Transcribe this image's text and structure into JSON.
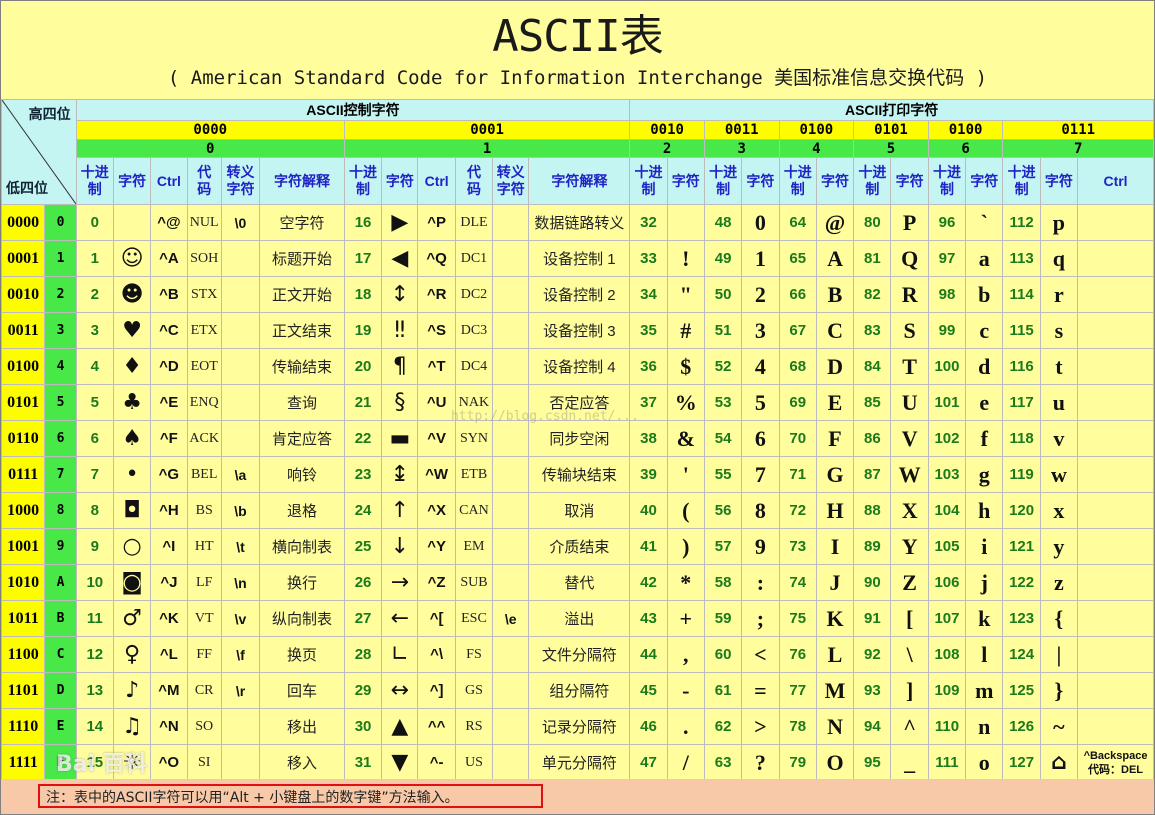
{
  "title": "ASCII表",
  "subtitle": "( American Standard Code for Information Interchange  美国标准信息交换代码 )",
  "corner": {
    "high": "高四位",
    "low": "低四位"
  },
  "categories": {
    "control": "ASCII控制字符",
    "printable": "ASCII打印字符"
  },
  "high_bits": [
    "0000",
    "0001",
    "0010",
    "0011",
    "0100",
    "0101",
    "0100",
    "0111"
  ],
  "high_nums": [
    "0",
    "1",
    "2",
    "3",
    "4",
    "5",
    "6",
    "7"
  ],
  "col_headers": {
    "dec": "十进制",
    "char": "字符",
    "ctrl": "Ctrl",
    "code": "代码",
    "esc": "转义字符",
    "desc": "字符解释"
  },
  "rows": [
    {
      "bin": "0000",
      "hex": "0",
      "c0": {
        "dec": "0",
        "char": "",
        "ctrl": "^@",
        "code": "NUL",
        "esc": "\\0",
        "desc": "空字符"
      },
      "c1": {
        "dec": "16",
        "char": "▶",
        "ctrl": "^P",
        "code": "DLE",
        "esc": "",
        "desc": "数据链路转义"
      },
      "p": [
        {
          "dec": "32",
          "char": ""
        },
        {
          "dec": "48",
          "char": "0"
        },
        {
          "dec": "64",
          "char": "@"
        },
        {
          "dec": "80",
          "char": "P"
        },
        {
          "dec": "96",
          "char": "`"
        },
        {
          "dec": "112",
          "char": "p"
        }
      ]
    },
    {
      "bin": "0001",
      "hex": "1",
      "c0": {
        "dec": "1",
        "char": "☺",
        "ctrl": "^A",
        "code": "SOH",
        "esc": "",
        "desc": "标题开始"
      },
      "c1": {
        "dec": "17",
        "char": "◀",
        "ctrl": "^Q",
        "code": "DC1",
        "esc": "",
        "desc": "设备控制 1"
      },
      "p": [
        {
          "dec": "33",
          "char": "!"
        },
        {
          "dec": "49",
          "char": "1"
        },
        {
          "dec": "65",
          "char": "A"
        },
        {
          "dec": "81",
          "char": "Q"
        },
        {
          "dec": "97",
          "char": "a"
        },
        {
          "dec": "113",
          "char": "q"
        }
      ]
    },
    {
      "bin": "0010",
      "hex": "2",
      "c0": {
        "dec": "2",
        "char": "☻",
        "ctrl": "^B",
        "code": "STX",
        "esc": "",
        "desc": "正文开始"
      },
      "c1": {
        "dec": "18",
        "char": "↕",
        "ctrl": "^R",
        "code": "DC2",
        "esc": "",
        "desc": "设备控制 2"
      },
      "p": [
        {
          "dec": "34",
          "char": "\""
        },
        {
          "dec": "50",
          "char": "2"
        },
        {
          "dec": "66",
          "char": "B"
        },
        {
          "dec": "82",
          "char": "R"
        },
        {
          "dec": "98",
          "char": "b"
        },
        {
          "dec": "114",
          "char": "r"
        }
      ]
    },
    {
      "bin": "0011",
      "hex": "3",
      "c0": {
        "dec": "3",
        "char": "♥",
        "ctrl": "^C",
        "code": "ETX",
        "esc": "",
        "desc": "正文结束"
      },
      "c1": {
        "dec": "19",
        "char": "‼",
        "ctrl": "^S",
        "code": "DC3",
        "esc": "",
        "desc": "设备控制 3"
      },
      "p": [
        {
          "dec": "35",
          "char": "#"
        },
        {
          "dec": "51",
          "char": "3"
        },
        {
          "dec": "67",
          "char": "C"
        },
        {
          "dec": "83",
          "char": "S"
        },
        {
          "dec": "99",
          "char": "c"
        },
        {
          "dec": "115",
          "char": "s"
        }
      ]
    },
    {
      "bin": "0100",
      "hex": "4",
      "c0": {
        "dec": "4",
        "char": "♦",
        "ctrl": "^D",
        "code": "EOT",
        "esc": "",
        "desc": "传输结束"
      },
      "c1": {
        "dec": "20",
        "char": "¶",
        "ctrl": "^T",
        "code": "DC4",
        "esc": "",
        "desc": "设备控制 4"
      },
      "p": [
        {
          "dec": "36",
          "char": "$"
        },
        {
          "dec": "52",
          "char": "4"
        },
        {
          "dec": "68",
          "char": "D"
        },
        {
          "dec": "84",
          "char": "T"
        },
        {
          "dec": "100",
          "char": "d"
        },
        {
          "dec": "116",
          "char": "t"
        }
      ]
    },
    {
      "bin": "0101",
      "hex": "5",
      "c0": {
        "dec": "5",
        "char": "♣",
        "ctrl": "^E",
        "code": "ENQ",
        "esc": "",
        "desc": "查询"
      },
      "c1": {
        "dec": "21",
        "char": "§",
        "ctrl": "^U",
        "code": "NAK",
        "esc": "",
        "desc": "否定应答"
      },
      "p": [
        {
          "dec": "37",
          "char": "%"
        },
        {
          "dec": "53",
          "char": "5"
        },
        {
          "dec": "69",
          "char": "E"
        },
        {
          "dec": "85",
          "char": "U"
        },
        {
          "dec": "101",
          "char": "e"
        },
        {
          "dec": "117",
          "char": "u"
        }
      ]
    },
    {
      "bin": "0110",
      "hex": "6",
      "c0": {
        "dec": "6",
        "char": "♠",
        "ctrl": "^F",
        "code": "ACK",
        "esc": "",
        "desc": "肯定应答"
      },
      "c1": {
        "dec": "22",
        "char": "▬",
        "ctrl": "^V",
        "code": "SYN",
        "esc": "",
        "desc": "同步空闲"
      },
      "p": [
        {
          "dec": "38",
          "char": "&"
        },
        {
          "dec": "54",
          "char": "6"
        },
        {
          "dec": "70",
          "char": "F"
        },
        {
          "dec": "86",
          "char": "V"
        },
        {
          "dec": "102",
          "char": "f"
        },
        {
          "dec": "118",
          "char": "v"
        }
      ]
    },
    {
      "bin": "0111",
      "hex": "7",
      "c0": {
        "dec": "7",
        "char": "•",
        "ctrl": "^G",
        "code": "BEL",
        "esc": "\\a",
        "desc": "响铃"
      },
      "c1": {
        "dec": "23",
        "char": "↨",
        "ctrl": "^W",
        "code": "ETB",
        "esc": "",
        "desc": "传输块结束"
      },
      "p": [
        {
          "dec": "39",
          "char": "'"
        },
        {
          "dec": "55",
          "char": "7"
        },
        {
          "dec": "71",
          "char": "G"
        },
        {
          "dec": "87",
          "char": "W"
        },
        {
          "dec": "103",
          "char": "g"
        },
        {
          "dec": "119",
          "char": "w"
        }
      ]
    },
    {
      "bin": "1000",
      "hex": "8",
      "c0": {
        "dec": "8",
        "char": "◘",
        "ctrl": "^H",
        "code": "BS",
        "esc": "\\b",
        "desc": "退格"
      },
      "c1": {
        "dec": "24",
        "char": "↑",
        "ctrl": "^X",
        "code": "CAN",
        "esc": "",
        "desc": "取消"
      },
      "p": [
        {
          "dec": "40",
          "char": "("
        },
        {
          "dec": "56",
          "char": "8"
        },
        {
          "dec": "72",
          "char": "H"
        },
        {
          "dec": "88",
          "char": "X"
        },
        {
          "dec": "104",
          "char": "h"
        },
        {
          "dec": "120",
          "char": "x"
        }
      ]
    },
    {
      "bin": "1001",
      "hex": "9",
      "c0": {
        "dec": "9",
        "char": "○",
        "ctrl": "^I",
        "code": "HT",
        "esc": "\\t",
        "desc": "横向制表"
      },
      "c1": {
        "dec": "25",
        "char": "↓",
        "ctrl": "^Y",
        "code": "EM",
        "esc": "",
        "desc": "介质结束"
      },
      "p": [
        {
          "dec": "41",
          "char": ")"
        },
        {
          "dec": "57",
          "char": "9"
        },
        {
          "dec": "73",
          "char": "I"
        },
        {
          "dec": "89",
          "char": "Y"
        },
        {
          "dec": "105",
          "char": "i"
        },
        {
          "dec": "121",
          "char": "y"
        }
      ]
    },
    {
      "bin": "1010",
      "hex": "A",
      "c0": {
        "dec": "10",
        "char": "◙",
        "ctrl": "^J",
        "code": "LF",
        "esc": "\\n",
        "desc": "换行"
      },
      "c1": {
        "dec": "26",
        "char": "→",
        "ctrl": "^Z",
        "code": "SUB",
        "esc": "",
        "desc": "替代"
      },
      "p": [
        {
          "dec": "42",
          "char": "*"
        },
        {
          "dec": "58",
          "char": ":"
        },
        {
          "dec": "74",
          "char": "J"
        },
        {
          "dec": "90",
          "char": "Z"
        },
        {
          "dec": "106",
          "char": "j"
        },
        {
          "dec": "122",
          "char": "z"
        }
      ]
    },
    {
      "bin": "1011",
      "hex": "B",
      "c0": {
        "dec": "11",
        "char": "♂",
        "ctrl": "^K",
        "code": "VT",
        "esc": "\\v",
        "desc": "纵向制表"
      },
      "c1": {
        "dec": "27",
        "char": "←",
        "ctrl": "^[",
        "code": "ESC",
        "esc": "\\e",
        "desc": "溢出"
      },
      "p": [
        {
          "dec": "43",
          "char": "+"
        },
        {
          "dec": "59",
          "char": ";"
        },
        {
          "dec": "75",
          "char": "K"
        },
        {
          "dec": "91",
          "char": "["
        },
        {
          "dec": "107",
          "char": "k"
        },
        {
          "dec": "123",
          "char": "{"
        }
      ]
    },
    {
      "bin": "1100",
      "hex": "C",
      "c0": {
        "dec": "12",
        "char": "♀",
        "ctrl": "^L",
        "code": "FF",
        "esc": "\\f",
        "desc": "换页"
      },
      "c1": {
        "dec": "28",
        "char": "∟",
        "ctrl": "^\\",
        "code": "FS",
        "esc": "",
        "desc": "文件分隔符"
      },
      "p": [
        {
          "dec": "44",
          "char": ","
        },
        {
          "dec": "60",
          "char": "<"
        },
        {
          "dec": "76",
          "char": "L"
        },
        {
          "dec": "92",
          "char": "\\"
        },
        {
          "dec": "108",
          "char": "l"
        },
        {
          "dec": "124",
          "char": "|"
        }
      ]
    },
    {
      "bin": "1101",
      "hex": "D",
      "c0": {
        "dec": "13",
        "char": "♪",
        "ctrl": "^M",
        "code": "CR",
        "esc": "\\r",
        "desc": "回车"
      },
      "c1": {
        "dec": "29",
        "char": "↔",
        "ctrl": "^]",
        "code": "GS",
        "esc": "",
        "desc": "组分隔符"
      },
      "p": [
        {
          "dec": "45",
          "char": "-"
        },
        {
          "dec": "61",
          "char": "="
        },
        {
          "dec": "77",
          "char": "M"
        },
        {
          "dec": "93",
          "char": "]"
        },
        {
          "dec": "109",
          "char": "m"
        },
        {
          "dec": "125",
          "char": "}"
        }
      ]
    },
    {
      "bin": "1110",
      "hex": "E",
      "c0": {
        "dec": "14",
        "char": "♫",
        "ctrl": "^N",
        "code": "SO",
        "esc": "",
        "desc": "移出"
      },
      "c1": {
        "dec": "30",
        "char": "▲",
        "ctrl": "^^",
        "code": "RS",
        "esc": "",
        "desc": "记录分隔符"
      },
      "p": [
        {
          "dec": "46",
          "char": "."
        },
        {
          "dec": "62",
          "char": ">"
        },
        {
          "dec": "78",
          "char": "N"
        },
        {
          "dec": "94",
          "char": "^"
        },
        {
          "dec": "110",
          "char": "n"
        },
        {
          "dec": "126",
          "char": "~"
        }
      ]
    },
    {
      "bin": "1111",
      "hex": "F",
      "c0": {
        "dec": "15",
        "char": "☼",
        "ctrl": "^O",
        "code": "SI",
        "esc": "",
        "desc": "移入"
      },
      "c1": {
        "dec": "31",
        "char": "▼",
        "ctrl": "^-",
        "code": "US",
        "esc": "",
        "desc": "单元分隔符"
      },
      "p": [
        {
          "dec": "47",
          "char": "/"
        },
        {
          "dec": "63",
          "char": "?"
        },
        {
          "dec": "79",
          "char": "O"
        },
        {
          "dec": "95",
          "char": "_"
        },
        {
          "dec": "111",
          "char": "o"
        },
        {
          "dec": "127",
          "char": "⌂"
        }
      ]
    }
  ],
  "del_note": {
    "line1": "^Backspace",
    "line2": "代码：DEL"
  },
  "footer_note": "注：表中的ASCII字符可以用“Alt + 小键盘上的数字键”方法输入。",
  "watermarks": {
    "center": "http://blog.csdn.net/...",
    "logo": "Bai 百科"
  }
}
